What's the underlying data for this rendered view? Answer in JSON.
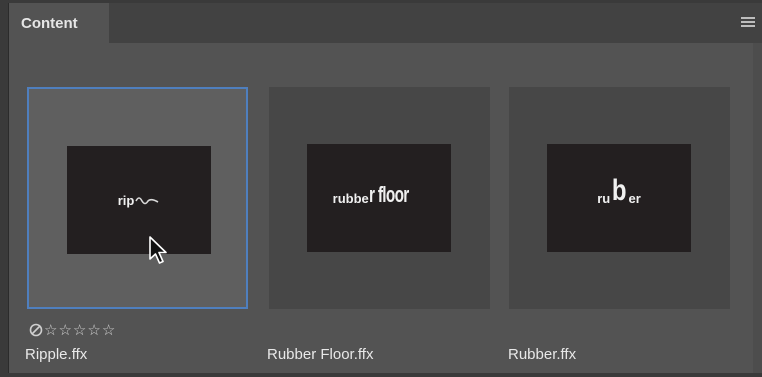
{
  "panel": {
    "tab_label": "Content",
    "menu_icon": "hamburger-menu-icon"
  },
  "items": [
    {
      "filename": "Ripple.ffx",
      "preview_text": "rip",
      "selected": true
    },
    {
      "filename": "Rubber Floor.ffx",
      "preview_text_a": "rubbe",
      "preview_text_b": "r floor",
      "selected": false
    },
    {
      "filename": "Rubber.ffx",
      "preview_text_a": "ru",
      "preview_text_b": "b",
      "preview_text_c": "er",
      "selected": false
    }
  ],
  "rating": {
    "reject_icon": "reject-circle-icon",
    "stars": 0,
    "max_stars": 5,
    "star_glyph": "☆"
  },
  "colors": {
    "selection_border": "#4f7fbe",
    "panel_bg": "#535353"
  }
}
